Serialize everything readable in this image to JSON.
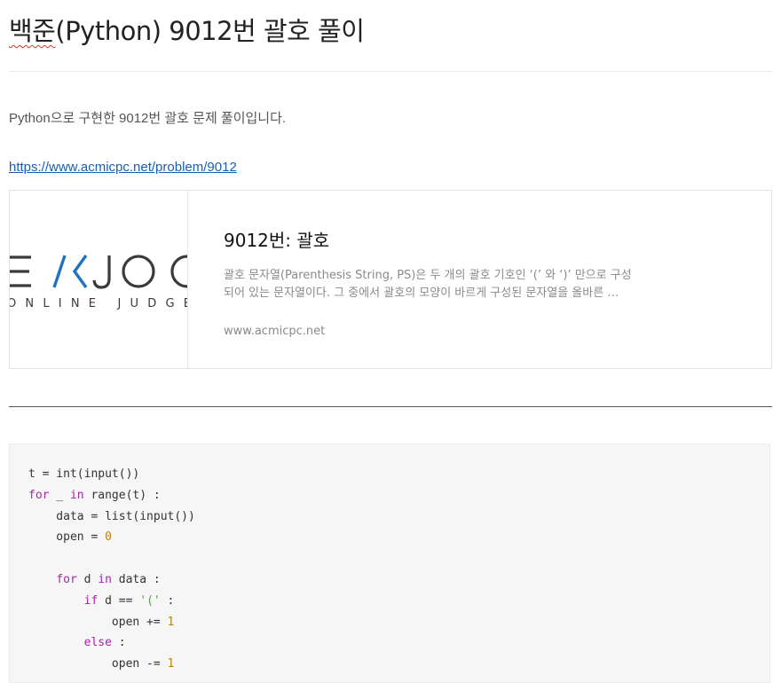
{
  "post": {
    "title_spell": "백준",
    "title_rest": "(Python) 9012번 괄호 풀이",
    "intro": "Python으로 구현한 9012번 괄호 문제 풀이입니다.",
    "link": "https://www.acmicpc.net/problem/9012"
  },
  "card": {
    "logo_letters": "EKJOC",
    "logo_subtitle": "ONLINE JUDGE",
    "title": "9012번: 괄호",
    "description": "괄호 문자열(Parenthesis String, PS)은 두 개의 괄호 기호인 ‘(’ 와 ‘)’ 만으로 구성되어 있는 문자열이다. 그 중에서 괄호의 모양이 바르게 구성된 문자열을 올바른 …",
    "domain": "www.acmicpc.net"
  },
  "code": {
    "language": "python",
    "lines": [
      "t = int(input())",
      "for _ in range(t) :",
      "    data = list(input())",
      "    open = 0",
      "",
      "    for d in data :",
      "        if d == '(' :",
      "            open += 1",
      "        else :",
      "            open -= 1"
    ]
  }
}
